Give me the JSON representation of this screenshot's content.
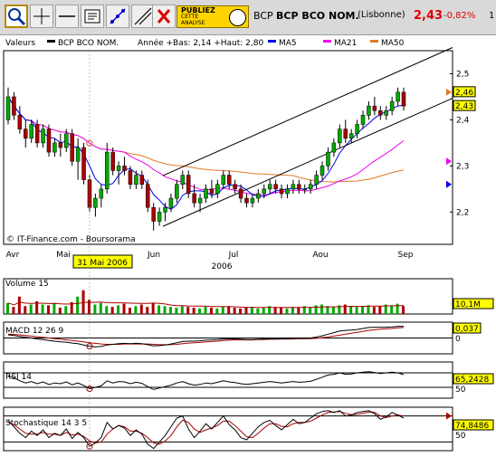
{
  "toolbar": {
    "tools": [
      "zoom-tool",
      "cursor-tool",
      "hline-tool",
      "text-tool",
      "fibonacci-tool",
      "trendline-tool",
      "delete-tool"
    ],
    "ad": {
      "line1": "PUBLIEZ",
      "line2": "CETTE",
      "line3": "ANALYSE"
    }
  },
  "header": {
    "ticker": "BCP",
    "name": "BCP BCO NOM.",
    "exchange": "(Lisbonne)",
    "price": "2,43",
    "change": "-0,82%",
    "extra": "1"
  },
  "legend": {
    "valeurs": "Valeurs",
    "series": "BCP BCO NOM.",
    "stats": "Année +Bas: 2,14 +Haut: 2,80",
    "ma5": "MA5",
    "ma21": "MA21",
    "ma50": "MA50"
  },
  "colors": {
    "up": "#00aa00",
    "down": "#aa0000",
    "ma5": "#0000ee",
    "ma21": "#ee00ee",
    "ma50": "#e07a20",
    "accent": "#ff0000",
    "cursor_bg": "#ffff00"
  },
  "cursor_date": "31 Mai 2006",
  "source": "© IT-Finance.com - Boursorama",
  "chart_data": [
    {
      "type": "candlestick",
      "title": "BCP BCO NOM.",
      "year_label": "2006",
      "months": [
        "Avr",
        "Mai",
        "Jun",
        "Jul",
        "Aou",
        "Sep"
      ],
      "yticks": [
        "2,5",
        "2,4",
        "2,3",
        "2,2"
      ],
      "ylim": [
        2.13,
        2.55
      ],
      "last_labels": [
        "2,46",
        "2,43"
      ],
      "series_names": [
        "MA5",
        "MA21",
        "MA50"
      ],
      "annotations": [
        "rising channel (2 trendlines)"
      ],
      "ohlc": [
        [
          2.4,
          2.47,
          2.39,
          2.45
        ],
        [
          2.45,
          2.46,
          2.4,
          2.41
        ],
        [
          2.41,
          2.43,
          2.37,
          2.38
        ],
        [
          2.38,
          2.4,
          2.34,
          2.36
        ],
        [
          2.36,
          2.4,
          2.35,
          2.39
        ],
        [
          2.39,
          2.4,
          2.34,
          2.35
        ],
        [
          2.35,
          2.39,
          2.34,
          2.38
        ],
        [
          2.38,
          2.39,
          2.32,
          2.33
        ],
        [
          2.33,
          2.36,
          2.32,
          2.35
        ],
        [
          2.35,
          2.37,
          2.32,
          2.34
        ],
        [
          2.34,
          2.38,
          2.33,
          2.37
        ],
        [
          2.37,
          2.38,
          2.3,
          2.31
        ],
        [
          2.31,
          2.36,
          2.27,
          2.34
        ],
        [
          2.34,
          2.35,
          2.26,
          2.27
        ],
        [
          2.27,
          2.28,
          2.2,
          2.21
        ],
        [
          2.21,
          2.24,
          2.19,
          2.23
        ],
        [
          2.23,
          2.26,
          2.21,
          2.25
        ],
        [
          2.25,
          2.35,
          2.24,
          2.33
        ],
        [
          2.33,
          2.34,
          2.28,
          2.29
        ],
        [
          2.29,
          2.31,
          2.26,
          2.3
        ],
        [
          2.3,
          2.32,
          2.28,
          2.29
        ],
        [
          2.29,
          2.3,
          2.25,
          2.26
        ],
        [
          2.26,
          2.29,
          2.25,
          2.28
        ],
        [
          2.28,
          2.29,
          2.25,
          2.26
        ],
        [
          2.26,
          2.27,
          2.2,
          2.21
        ],
        [
          2.21,
          2.22,
          2.16,
          2.18
        ],
        [
          2.18,
          2.21,
          2.17,
          2.2
        ],
        [
          2.2,
          2.22,
          2.18,
          2.21
        ],
        [
          2.21,
          2.24,
          2.2,
          2.23
        ],
        [
          2.23,
          2.27,
          2.22,
          2.26
        ],
        [
          2.26,
          2.29,
          2.25,
          2.28
        ],
        [
          2.28,
          2.29,
          2.23,
          2.24
        ],
        [
          2.24,
          2.26,
          2.21,
          2.22
        ],
        [
          2.22,
          2.24,
          2.2,
          2.23
        ],
        [
          2.23,
          2.26,
          2.22,
          2.25
        ],
        [
          2.25,
          2.27,
          2.23,
          2.24
        ],
        [
          2.24,
          2.27,
          2.23,
          2.26
        ],
        [
          2.26,
          2.29,
          2.25,
          2.28
        ],
        [
          2.28,
          2.29,
          2.25,
          2.26
        ],
        [
          2.26,
          2.27,
          2.24,
          2.25
        ],
        [
          2.25,
          2.26,
          2.22,
          2.23
        ],
        [
          2.23,
          2.24,
          2.21,
          2.22
        ],
        [
          2.22,
          2.24,
          2.21,
          2.23
        ],
        [
          2.23,
          2.25,
          2.22,
          2.24
        ],
        [
          2.24,
          2.26,
          2.23,
          2.25
        ],
        [
          2.25,
          2.27,
          2.24,
          2.26
        ],
        [
          2.26,
          2.27,
          2.24,
          2.25
        ],
        [
          2.25,
          2.26,
          2.23,
          2.24
        ],
        [
          2.24,
          2.26,
          2.23,
          2.25
        ],
        [
          2.25,
          2.27,
          2.24,
          2.26
        ],
        [
          2.26,
          2.27,
          2.24,
          2.25
        ],
        [
          2.25,
          2.26,
          2.24,
          2.25
        ],
        [
          2.25,
          2.27,
          2.24,
          2.26
        ],
        [
          2.26,
          2.29,
          2.25,
          2.28
        ],
        [
          2.28,
          2.31,
          2.27,
          2.3
        ],
        [
          2.3,
          2.34,
          2.29,
          2.33
        ],
        [
          2.33,
          2.36,
          2.32,
          2.35
        ],
        [
          2.35,
          2.39,
          2.34,
          2.38
        ],
        [
          2.38,
          2.4,
          2.35,
          2.36
        ],
        [
          2.36,
          2.38,
          2.35,
          2.37
        ],
        [
          2.37,
          2.4,
          2.36,
          2.39
        ],
        [
          2.39,
          2.42,
          2.38,
          2.41
        ],
        [
          2.41,
          2.44,
          2.4,
          2.43
        ],
        [
          2.43,
          2.45,
          2.41,
          2.42
        ],
        [
          2.42,
          2.43,
          2.4,
          2.41
        ],
        [
          2.41,
          2.43,
          2.4,
          2.42
        ],
        [
          2.42,
          2.45,
          2.41,
          2.44
        ],
        [
          2.44,
          2.47,
          2.43,
          2.46
        ],
        [
          2.46,
          2.47,
          2.42,
          2.43
        ]
      ],
      "volume_ylim": [
        0,
        40
      ],
      "volume": [
        14,
        9,
        22,
        10,
        12,
        16,
        12,
        11,
        14,
        8,
        10,
        15,
        22,
        30,
        18,
        12,
        14,
        10,
        9,
        11,
        13,
        8,
        10,
        12,
        9,
        14,
        11,
        10,
        9,
        8,
        10,
        9,
        8,
        7,
        9,
        8,
        7,
        9,
        10,
        8,
        7,
        8,
        9,
        7,
        8,
        10,
        9,
        8,
        7,
        9,
        8,
        10,
        9,
        11,
        12,
        10,
        9,
        11,
        12,
        10,
        9,
        10,
        11,
        9,
        10,
        12,
        11,
        13,
        10
      ],
      "volume_label": "Volume 15",
      "volume_last": "10,1M",
      "macd_label": "MACD 12 26 9",
      "macd_last": "0,037",
      "macd_ylim": [
        -0.05,
        0.05
      ],
      "macd": [
        0.01,
        0.008,
        0.005,
        0.002,
        0.0,
        -0.003,
        -0.005,
        -0.008,
        -0.01,
        -0.012,
        -0.013,
        -0.016,
        -0.018,
        -0.022,
        -0.026,
        -0.028,
        -0.027,
        -0.022,
        -0.02,
        -0.018,
        -0.017,
        -0.018,
        -0.017,
        -0.018,
        -0.021,
        -0.025,
        -0.024,
        -0.022,
        -0.019,
        -0.015,
        -0.011,
        -0.01,
        -0.01,
        -0.009,
        -0.007,
        -0.006,
        -0.005,
        -0.003,
        -0.003,
        -0.003,
        -0.004,
        -0.005,
        -0.005,
        -0.004,
        -0.003,
        -0.002,
        -0.002,
        -0.002,
        -0.002,
        -0.001,
        -0.001,
        -0.001,
        0.0,
        0.003,
        0.007,
        0.012,
        0.017,
        0.022,
        0.024,
        0.025,
        0.027,
        0.03,
        0.033,
        0.034,
        0.034,
        0.034,
        0.035,
        0.037,
        0.037
      ],
      "macd_signal": [
        0.012,
        0.011,
        0.01,
        0.008,
        0.006,
        0.004,
        0.002,
        0.0,
        -0.002,
        -0.004,
        -0.006,
        -0.008,
        -0.01,
        -0.012,
        -0.015,
        -0.017,
        -0.019,
        -0.02,
        -0.02,
        -0.02,
        -0.019,
        -0.019,
        -0.019,
        -0.019,
        -0.019,
        -0.02,
        -0.021,
        -0.021,
        -0.021,
        -0.02,
        -0.018,
        -0.016,
        -0.015,
        -0.014,
        -0.012,
        -0.011,
        -0.01,
        -0.008,
        -0.007,
        -0.006,
        -0.006,
        -0.006,
        -0.006,
        -0.005,
        -0.005,
        -0.004,
        -0.004,
        -0.003,
        -0.003,
        -0.003,
        -0.002,
        -0.002,
        -0.002,
        -0.001,
        0.001,
        0.003,
        0.006,
        0.009,
        0.012,
        0.015,
        0.018,
        0.021,
        0.024,
        0.026,
        0.028,
        0.029,
        0.03,
        0.032,
        0.033
      ],
      "rsi_label": "RSI 14",
      "rsi_last": "65,2428",
      "rsi_ylim": [
        0,
        100
      ],
      "rsi": [
        62,
        56,
        48,
        42,
        46,
        40,
        45,
        38,
        42,
        40,
        45,
        37,
        42,
        35,
        26,
        30,
        34,
        48,
        42,
        46,
        45,
        40,
        44,
        41,
        32,
        24,
        28,
        32,
        36,
        42,
        46,
        40,
        36,
        38,
        42,
        40,
        44,
        48,
        45,
        43,
        40,
        38,
        40,
        42,
        44,
        46,
        44,
        42,
        44,
        46,
        44,
        45,
        47,
        52,
        58,
        64,
        66,
        70,
        66,
        67,
        70,
        72,
        73,
        71,
        68,
        70,
        72,
        70,
        65
      ],
      "stoch_label": "Stochastique 14 3 5",
      "stoch_last": "74,8486",
      "stoch_ylim": [
        0,
        100
      ],
      "stoch_k": [
        70,
        55,
        40,
        30,
        45,
        35,
        48,
        30,
        40,
        35,
        50,
        28,
        42,
        30,
        10,
        18,
        30,
        65,
        50,
        58,
        52,
        35,
        48,
        38,
        15,
        5,
        20,
        35,
        55,
        75,
        80,
        50,
        30,
        45,
        62,
        50,
        65,
        80,
        60,
        48,
        30,
        25,
        40,
        55,
        65,
        70,
        58,
        48,
        60,
        72,
        62,
        65,
        75,
        85,
        90,
        92,
        88,
        92,
        80,
        82,
        88,
        90,
        92,
        85,
        72,
        78,
        88,
        82,
        75
      ],
      "stoch_d": [
        65,
        60,
        50,
        40,
        38,
        38,
        42,
        38,
        38,
        35,
        42,
        36,
        38,
        33,
        22,
        18,
        20,
        38,
        50,
        58,
        55,
        45,
        45,
        40,
        30,
        18,
        15,
        22,
        35,
        55,
        70,
        65,
        50,
        42,
        48,
        52,
        58,
        68,
        68,
        58,
        45,
        32,
        30,
        40,
        52,
        62,
        62,
        56,
        55,
        62,
        65,
        65,
        68,
        75,
        82,
        88,
        89,
        90,
        86,
        83,
        84,
        86,
        89,
        88,
        80,
        76,
        80,
        82,
        80
      ]
    }
  ]
}
